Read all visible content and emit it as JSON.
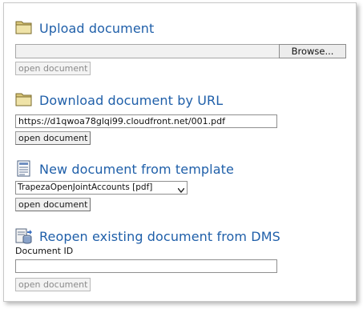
{
  "upload": {
    "title": "Upload document",
    "browse_label": "Browse...",
    "open_label": "open document"
  },
  "download_url": {
    "title": "Download document by URL",
    "url_value": "https://d1qwoa78glqi99.cloudfront.net/001.pdf",
    "open_label": "open document"
  },
  "template": {
    "title": "New document from template",
    "selected_option": "TrapezaOpenJointAccounts [pdf]",
    "open_label": "open document"
  },
  "dms": {
    "title": "Reopen existing document from DMS",
    "field_label": "Document ID",
    "field_value": "",
    "open_label": "open document"
  },
  "icons": {
    "upload": "folder-icon",
    "download": "folder-icon",
    "template": "template-document-icon",
    "dms": "dms-database-icon"
  },
  "colors": {
    "title_text": "#1f5fa9",
    "folder_fill": "#e8d99a",
    "disabled_text": "#8a8a8a"
  }
}
